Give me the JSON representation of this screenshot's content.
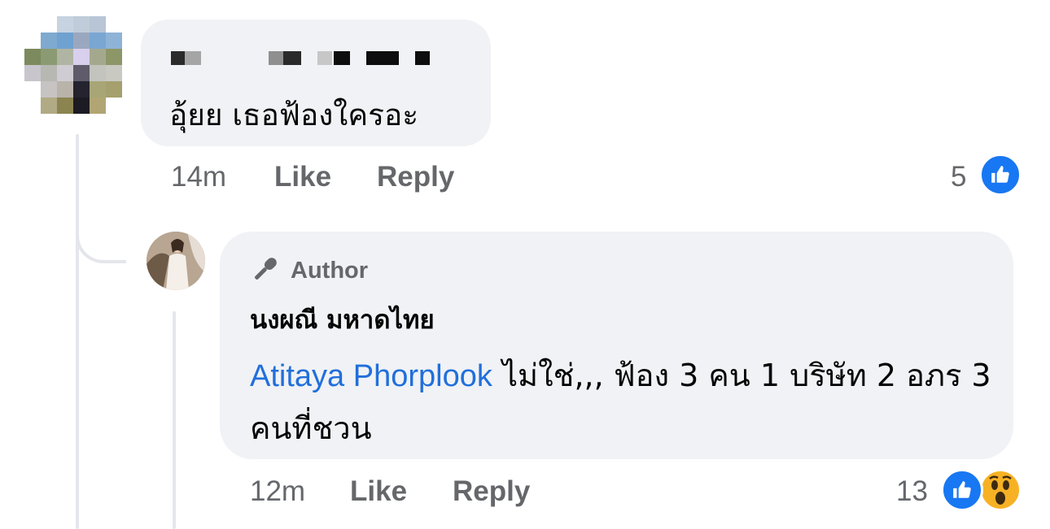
{
  "comments": [
    {
      "author_name": "",
      "text": "อุ้ยย เธอฟ้องใครอะ",
      "time": "14m",
      "like_label": "Like",
      "reply_label": "Reply",
      "reaction_count": "5",
      "reactions": [
        "like-icon"
      ]
    },
    {
      "badge_label": "Author",
      "author_name": "นงผณี มหาดไทย",
      "mention": "Atitaya Phorplook",
      "text": "ไม่ใช่,,, ฟ้อง 3 คน 1 บริษัท 2 อภร 3 คนที่ชวน",
      "time": "12m",
      "like_label": "Like",
      "reply_label": "Reply",
      "reaction_count": "13",
      "reactions": [
        "like-icon",
        "wow-icon"
      ]
    }
  ],
  "colors": {
    "bubble": "#f0f2f5",
    "meta_text": "#65676b",
    "mention": "#216fdb",
    "like_blue": "#1877f2",
    "wow_yellow": "#f7b125"
  }
}
